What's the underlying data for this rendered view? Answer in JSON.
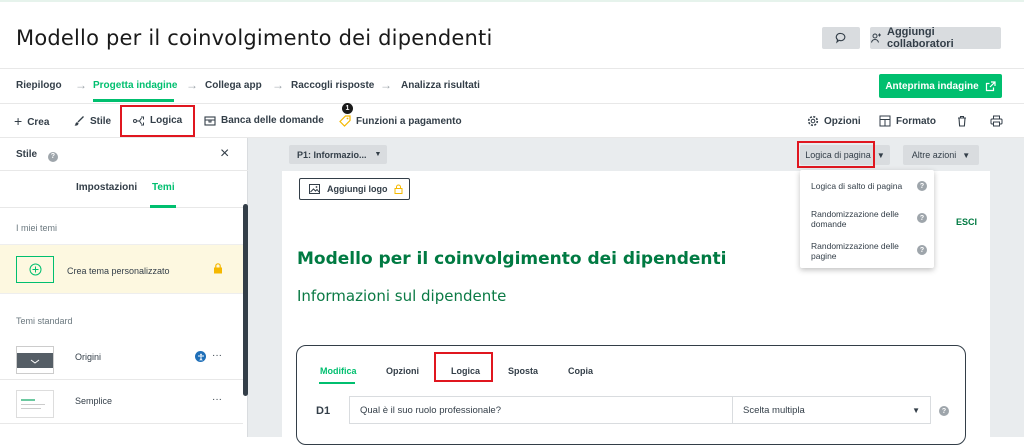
{
  "header": {
    "title": "Modello per il coinvolgimento dei dipendenti",
    "add_collaborators": "Aggiungi collaboratori"
  },
  "steps": [
    "Riepilogo",
    "Progetta indagine",
    "Collega app",
    "Raccogli risposte",
    "Analizza risultati"
  ],
  "active_step": "Progetta indagine",
  "preview_label": "Anteprima indagine",
  "toolbar": {
    "create": "Crea",
    "style": "Stile",
    "logic": "Logica",
    "question_bank": "Banca delle domande",
    "paid_features": "Funzioni a pagamento",
    "paid_badge": "1",
    "options": "Opzioni",
    "format": "Formato"
  },
  "sidebar": {
    "title": "Stile",
    "close": "×",
    "tabs": [
      "Impostazioni",
      "Temi"
    ],
    "active_tab": "Temi",
    "my_themes_label": "I miei temi",
    "create_theme": "Crea tema personalizzato",
    "standard_label": "Temi standard",
    "themes": [
      {
        "name": "Origini",
        "more": "···"
      },
      {
        "name": "Semplice",
        "more": "···"
      }
    ]
  },
  "canvas": {
    "page_select": "P1: Informazio...",
    "page_logic": "Logica di pagina",
    "more_actions": "Altre azioni",
    "dropdown_items": [
      "Logica di salto di pagina",
      "Randomizzazione delle domande",
      "Randomizzazione delle pagine"
    ],
    "add_logo": "Aggiungi logo",
    "exit": "ESCI",
    "survey_title": "Modello per il coinvolgimento dei dipendenti",
    "survey_subtitle": "Informazioni sul dipendente"
  },
  "question": {
    "tabs": [
      "Modifica",
      "Opzioni",
      "Logica",
      "Sposta",
      "Copia"
    ],
    "active_tab": "Modifica",
    "number": "D1",
    "text": "Qual è il suo ruolo professionale?",
    "type": "Scelta multipla"
  },
  "colors": {
    "accent": "#00bf6f",
    "dark_green": "#007a42",
    "highlight": "#e0161f"
  }
}
